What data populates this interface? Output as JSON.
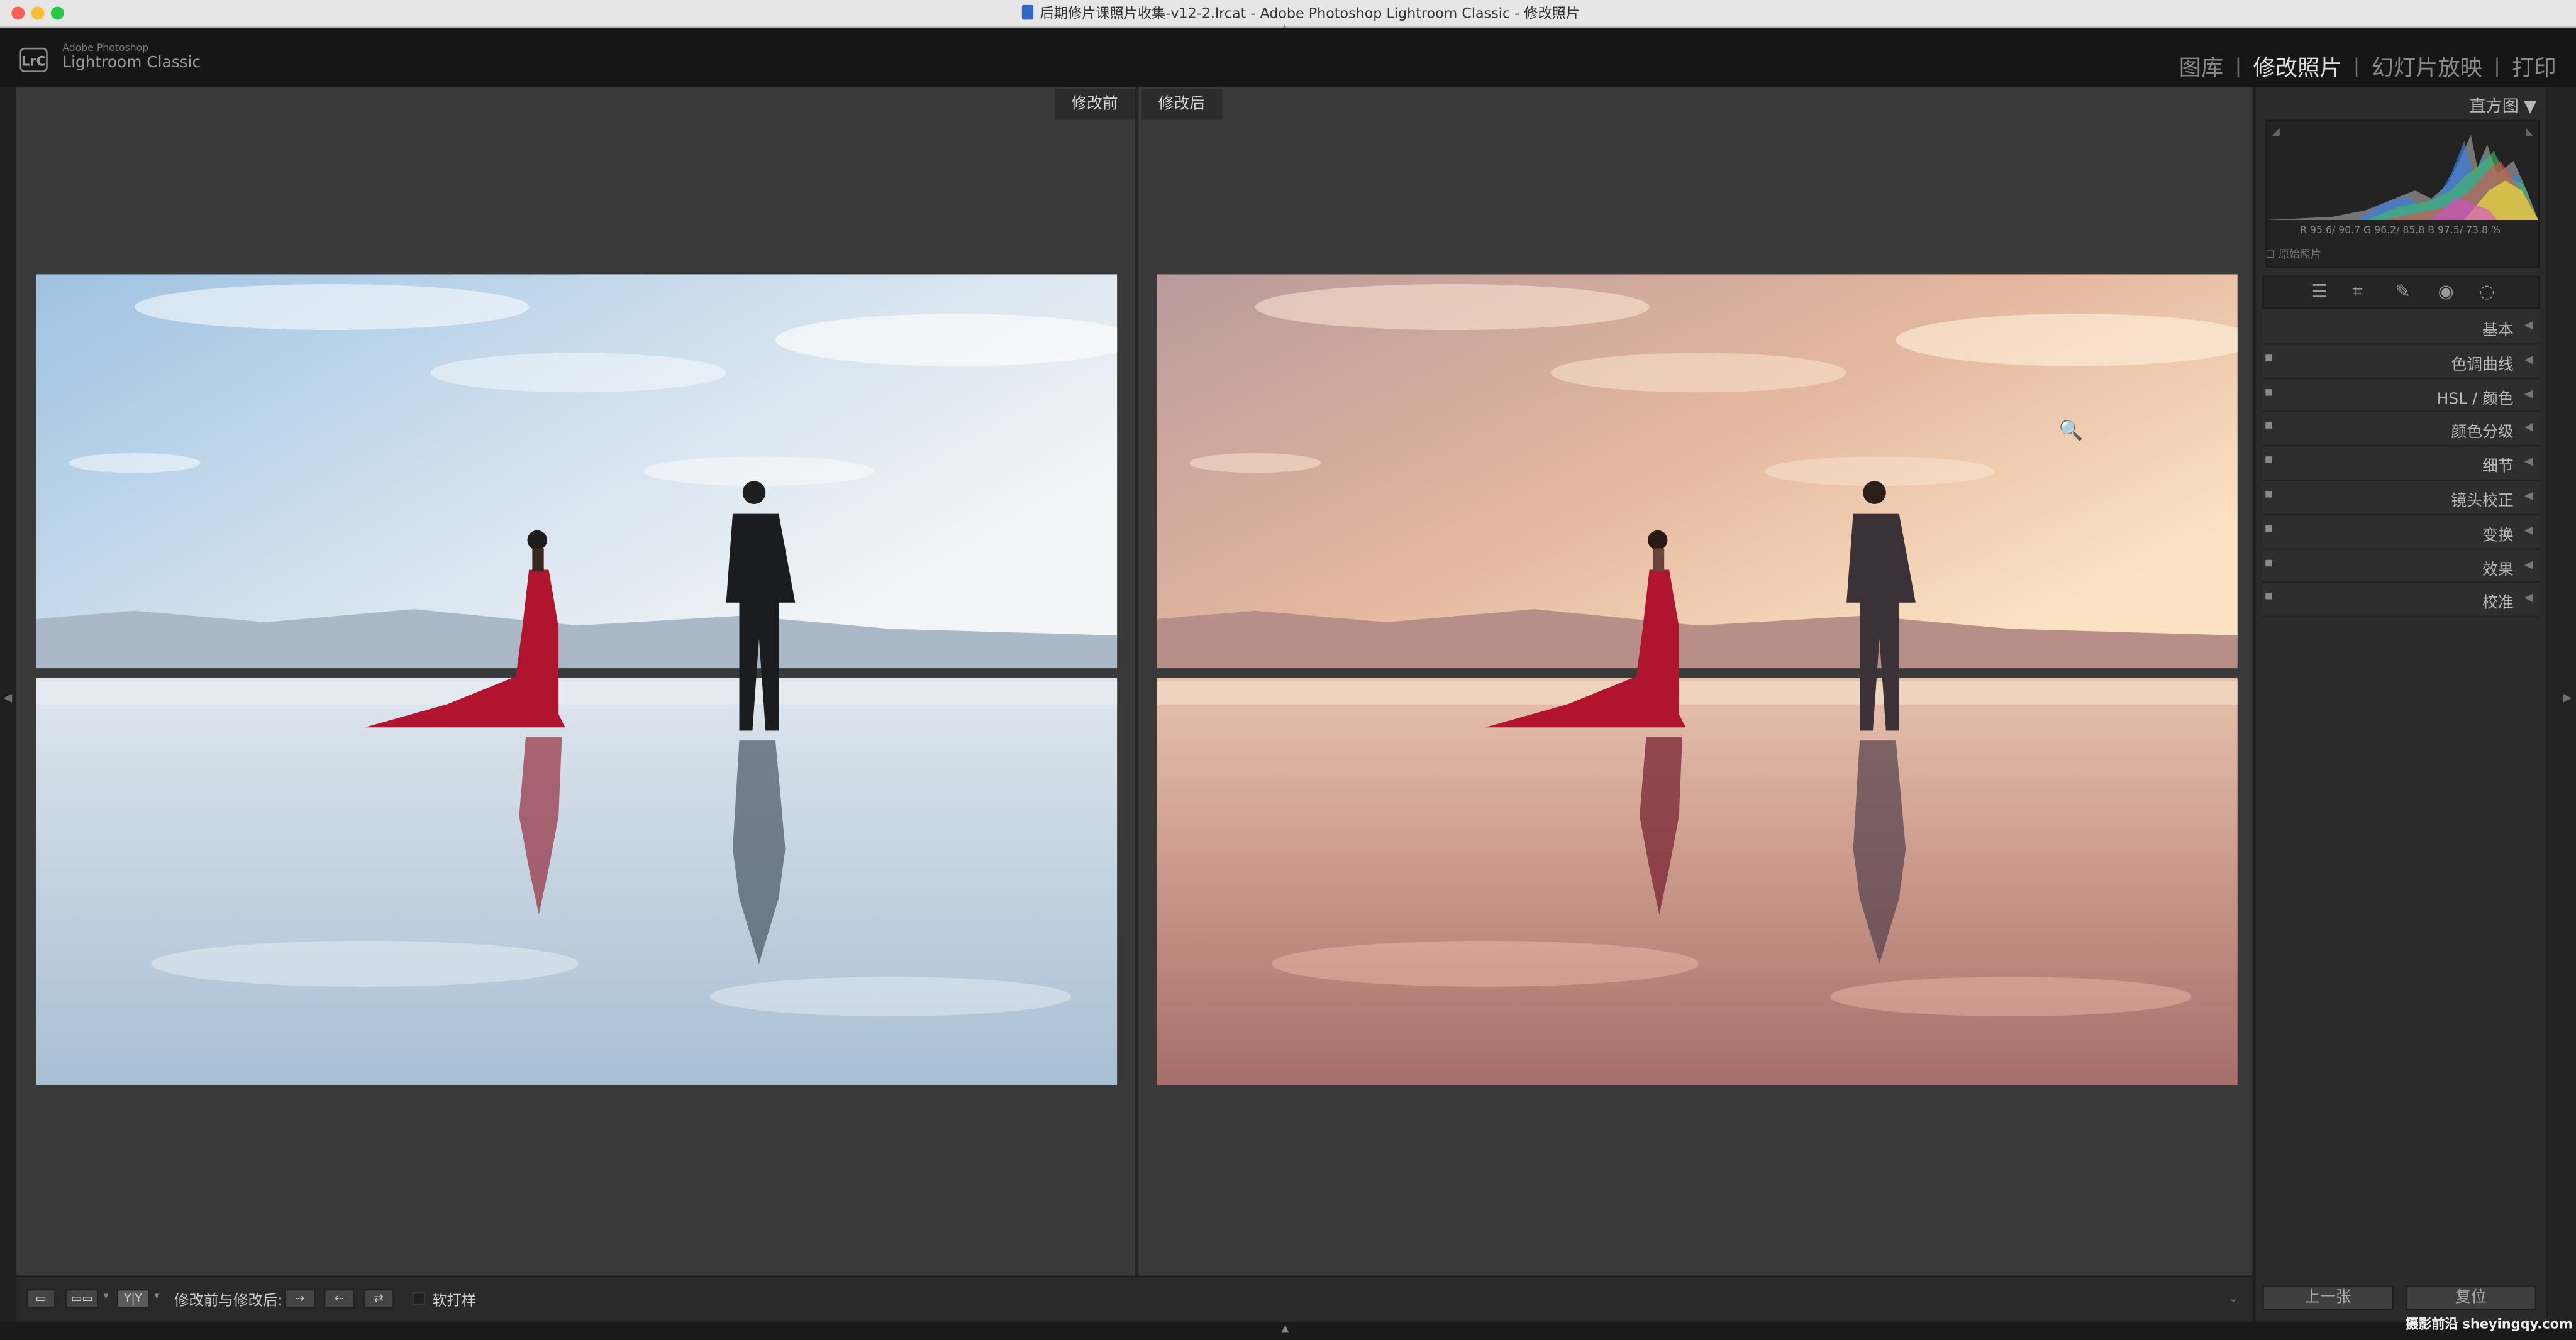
{
  "window": {
    "title": "后期修片课照片收集-v12-2.lrcat - Adobe Photoshop Lightroom Classic - 修改照片"
  },
  "app": {
    "vendor": "Adobe Photoshop",
    "name": "Lightroom Classic",
    "logo": "LrC"
  },
  "modules": {
    "library": "图库",
    "develop": "修改照片",
    "slideshow": "幻灯片放映",
    "print": "打印",
    "active": "develop"
  },
  "compare": {
    "before_label": "修改前",
    "after_label": "修改后"
  },
  "histogram": {
    "title": "直方图",
    "readout": "R  95.6/ 90.7  G  96.2/ 85.8  B  97.5/ 73.8  %",
    "original_photo_label": "原始照片"
  },
  "tools": [
    "adjust-sliders-icon",
    "crop-icon",
    "healing-brush-icon",
    "red-eye-icon",
    "masking-icon"
  ],
  "panel_sections": [
    {
      "name": "基本",
      "has_switch": false
    },
    {
      "name": "色调曲线",
      "has_switch": true
    },
    {
      "name": "HSL / 颜色",
      "has_switch": true
    },
    {
      "name": "颜色分级",
      "has_switch": true
    },
    {
      "name": "细节",
      "has_switch": true
    },
    {
      "name": "镜头校正",
      "has_switch": true
    },
    {
      "name": "变换",
      "has_switch": true
    },
    {
      "name": "效果",
      "has_switch": true
    },
    {
      "name": "校准",
      "has_switch": true
    }
  ],
  "toolbar": {
    "view_label": "修改前与修改后:",
    "soft_proof_label": "软打样",
    "yy_label": "Y|Y"
  },
  "buttons": {
    "previous": "上一张",
    "reset": "复位"
  },
  "watermark": "摄影前沿 sheyingqy.com",
  "colors": {
    "accent_before_sky": "#c9d9e8",
    "accent_after_sky": "#e9b89c",
    "dress_red": "#b0142e"
  }
}
